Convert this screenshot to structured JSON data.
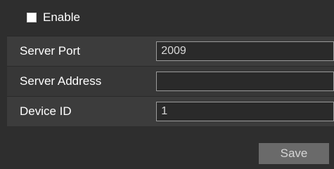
{
  "enable": {
    "label": "Enable",
    "checked": false
  },
  "fields": [
    {
      "label": "Server Port",
      "value": "2009"
    },
    {
      "label": "Server Address",
      "value": ""
    },
    {
      "label": "Device ID",
      "value": "1"
    }
  ],
  "actions": {
    "save_label": "Save"
  },
  "colors": {
    "background": "#2e2e2e",
    "row_background": "#3c3c3c",
    "input_border": "#9a9a9a",
    "button_background": "#6a6a6a",
    "text": "#ffffff"
  }
}
